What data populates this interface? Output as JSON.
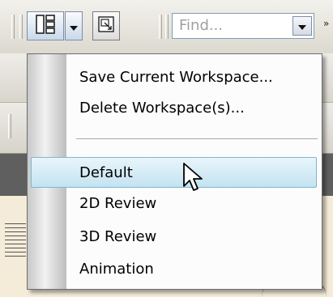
{
  "toolbar": {
    "workspace_button_icon": "workspace-layout-icon",
    "dropdown_arrow_icon": "chevron-down-icon",
    "secondary_button_icon": "restore-view-icon",
    "find_placeholder": "Find...",
    "overflow_icon": "chevron-right-icon"
  },
  "workspace_menu": {
    "items": [
      {
        "label": "Save Current Workspace..."
      },
      {
        "label": "Delete Workspace(s)..."
      }
    ],
    "workspaces": [
      {
        "label": "Default",
        "highlighted": true
      },
      {
        "label": "2D Review"
      },
      {
        "label": "3D Review"
      },
      {
        "label": "Animation"
      }
    ]
  },
  "colors": {
    "highlight_fill": "#c3e3f1",
    "highlight_border": "#7fb6d0",
    "menu_background": "#fcfcfc"
  }
}
